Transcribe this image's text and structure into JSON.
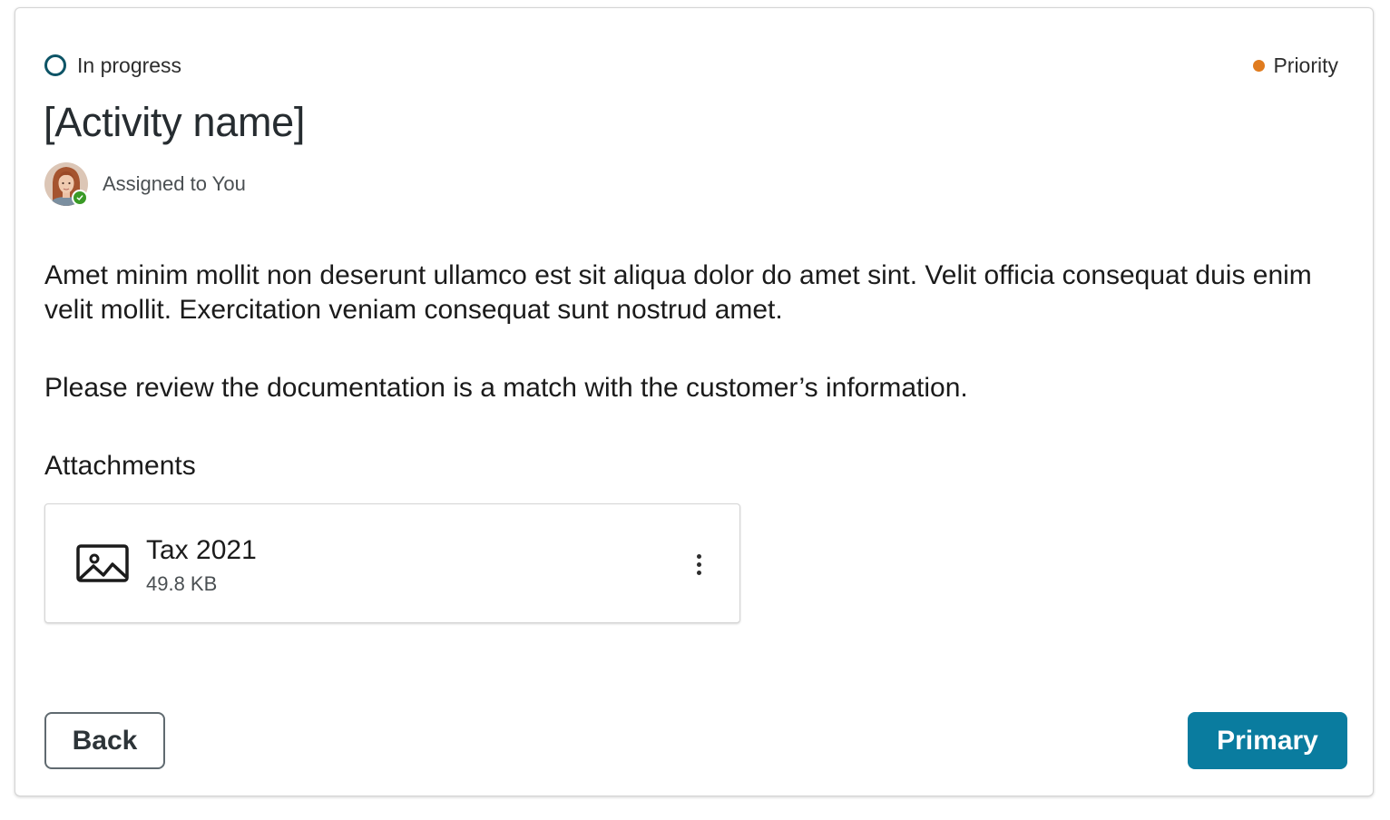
{
  "activity": {
    "status": {
      "label": "In progress",
      "icon": "progress-ring-icon",
      "color": "#0d5466"
    },
    "priority": {
      "label": "Priority",
      "color": "#e07b1e"
    },
    "title": "[Activity name]",
    "assignee": {
      "label": "Assigned to You",
      "status_badge_color": "#3a9a26"
    },
    "description": "Amet minim mollit non deserunt ullamco est sit aliqua dolor do amet sint. Velit officia consequat duis enim velit mollit. Exercitation veniam consequat sunt nostrud amet.",
    "instruction": "Please review the documentation is a match with the customer’s information."
  },
  "attachments": {
    "heading": "Attachments",
    "items": [
      {
        "name": "Tax 2021",
        "size": "49.8 KB",
        "icon": "image-file-icon"
      }
    ]
  },
  "actions": {
    "back_label": "Back",
    "primary_label": "Primary",
    "primary_color": "#0a7c9f"
  }
}
